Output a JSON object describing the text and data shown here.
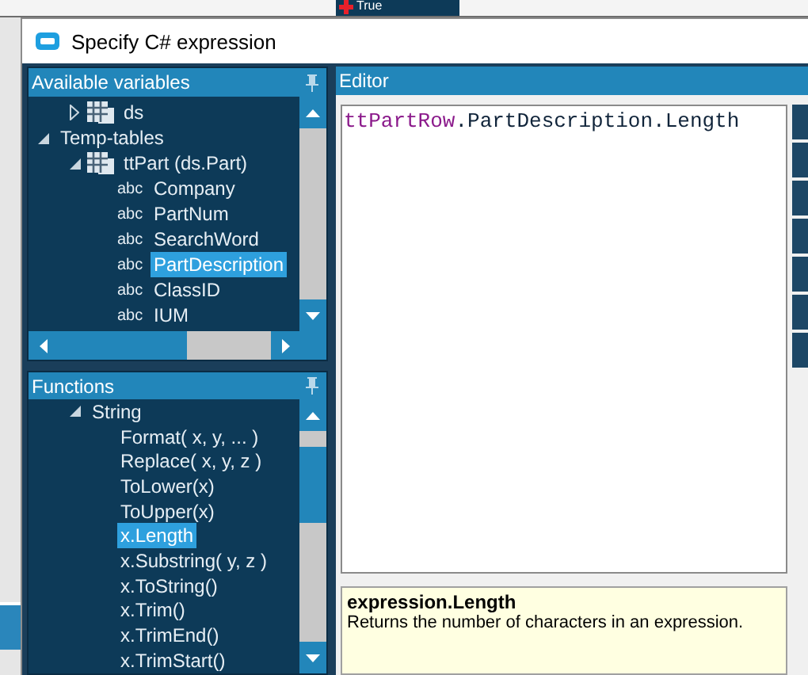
{
  "background": {
    "button": {
      "label": "True"
    }
  },
  "window": {
    "title": "Specify C# expression"
  },
  "variables_panel": {
    "title": "Available variables",
    "items": [
      {
        "kind": "continuation",
        "children": [
          {
            "label": "ds",
            "kind": "table",
            "expanded": false,
            "selected": false
          }
        ]
      },
      {
        "label": "Temp-tables",
        "kind": "folder",
        "expanded": true,
        "selected": false,
        "children": [
          {
            "label": "ttPart (ds.Part)",
            "kind": "table",
            "expanded": true,
            "selected": false,
            "children": [
              {
                "label": "Company",
                "kind": "field",
                "type_label": "abc",
                "selected": false
              },
              {
                "label": "PartNum",
                "kind": "field",
                "type_label": "abc",
                "selected": false
              },
              {
                "label": "SearchWord",
                "kind": "field",
                "type_label": "abc",
                "selected": false
              },
              {
                "label": "PartDescription",
                "kind": "field",
                "type_label": "abc",
                "selected": true
              },
              {
                "label": "ClassID",
                "kind": "field",
                "type_label": "abc",
                "selected": false
              },
              {
                "label": "IUM",
                "kind": "field",
                "type_label": "abc",
                "selected": false
              }
            ]
          }
        ]
      }
    ]
  },
  "functions_panel": {
    "title": "Functions",
    "items": [
      {
        "kind": "continuation",
        "children": [
          {
            "label": "String",
            "kind": "folder",
            "expanded": true,
            "selected": false,
            "children": [
              {
                "label": "Format( x, y, ... )",
                "selected": false
              },
              {
                "label": "Replace( x, y, z )",
                "selected": false
              },
              {
                "label": "ToLower(x)",
                "selected": false
              },
              {
                "label": "ToUpper(x)",
                "selected": false
              },
              {
                "label": "x.Length",
                "selected": true
              },
              {
                "label": "x.Substring( y, z )",
                "selected": false
              },
              {
                "label": "x.ToString()",
                "selected": false
              },
              {
                "label": "x.Trim()",
                "selected": false
              },
              {
                "label": "x.TrimEnd()",
                "selected": false
              },
              {
                "label": "x.TrimStart()",
                "selected": false
              }
            ]
          }
        ]
      }
    ]
  },
  "editor": {
    "title": "Editor",
    "tokens": [
      {
        "text": "ttPartRow",
        "kind": "variable"
      },
      {
        "text": ".PartDescription.Length",
        "kind": "member"
      }
    ]
  },
  "help": {
    "title": "expression.Length",
    "description": "Returns the number of characters in an expression."
  }
}
